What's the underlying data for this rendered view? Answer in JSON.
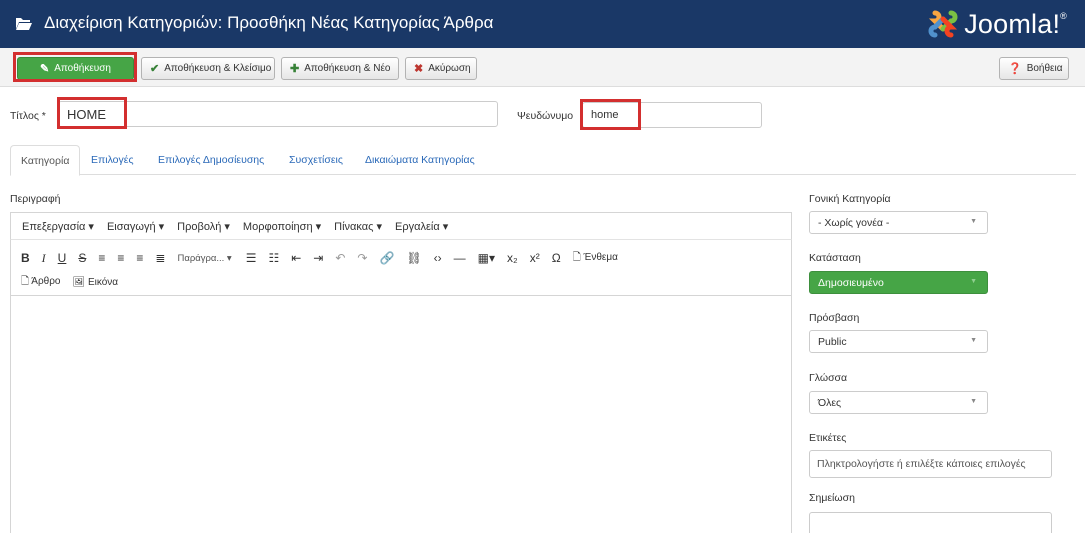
{
  "header": {
    "title": "Διαχείριση Κατηγοριών: Προσθήκη Νέας Κατηγορίας Άρθρα",
    "logo_text": "Joomla!",
    "logo_mark": "®"
  },
  "toolbar": {
    "save_label": "Αποθήκευση",
    "save_close_label": "Αποθήκευση & Κλείσιμο",
    "save_new_label": "Αποθήκευση & Νέο",
    "cancel_label": "Ακύρωση",
    "help_label": "Βοήθεια"
  },
  "form": {
    "title_label": "Τίτλος *",
    "title_value": "HOME",
    "alias_label": "Ψευδώνυμο",
    "alias_value": "home"
  },
  "tabs": [
    {
      "label": "Κατηγορία",
      "active": true
    },
    {
      "label": "Επιλογές",
      "active": false
    },
    {
      "label": "Επιλογές Δημοσίευσης",
      "active": false
    },
    {
      "label": "Συσχετίσεις",
      "active": false
    },
    {
      "label": "Δικαιώματα Κατηγορίας",
      "active": false
    }
  ],
  "editor": {
    "description_label": "Περιγραφή",
    "menus": [
      "Επεξεργασία ▾",
      "Εισαγωγή ▾",
      "Προβολή ▾",
      "Μορφοποίηση ▾",
      "Πίνακας ▾",
      "Εργαλεία ▾"
    ],
    "paragraph_label": "Παράγρα... ▾",
    "module_label": "Ένθεμα",
    "article_label": "Άρθρο",
    "image_label": "Εικόνα"
  },
  "sidebar": {
    "parent_label": "Γονική Κατηγορία",
    "parent_value": "- Χωρίς γονέα -",
    "status_label": "Κατάσταση",
    "status_value": "Δημοσιευμένο",
    "access_label": "Πρόσβαση",
    "access_value": "Public",
    "language_label": "Γλώσσα",
    "language_value": "Όλες",
    "tags_label": "Ετικέτες",
    "tags_placeholder": "Πληκτρολογήστε ή επιλέξτε κάποιες επιλογές",
    "note_label": "Σημείωση"
  },
  "colors": {
    "header_bg": "#1a3867",
    "save_green": "#46a546",
    "highlight_red": "#d32f2f",
    "link_blue": "#2a69b8"
  }
}
